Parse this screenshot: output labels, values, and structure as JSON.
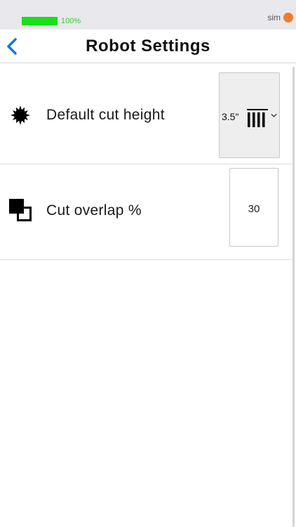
{
  "status_bar": {
    "battery_text": "100%",
    "battery_level": 1.0,
    "carrier": "sim",
    "indicator_color": "#f07c2c",
    "battery_color": "#15e115"
  },
  "nav": {
    "back_icon": "chevron-left-icon",
    "title": "Robot Settings",
    "accent_color": "#1a73e8"
  },
  "settings": {
    "cut_height": {
      "icon": "sun-burst-icon",
      "label": "Default cut height",
      "value": "3.5\"",
      "value_icon": "grass-height-icon",
      "dropdown_icon": "chevron-down-icon"
    },
    "cut_overlap": {
      "icon": "overlap-squares-icon",
      "label": "Cut overlap %",
      "value": "30"
    }
  }
}
